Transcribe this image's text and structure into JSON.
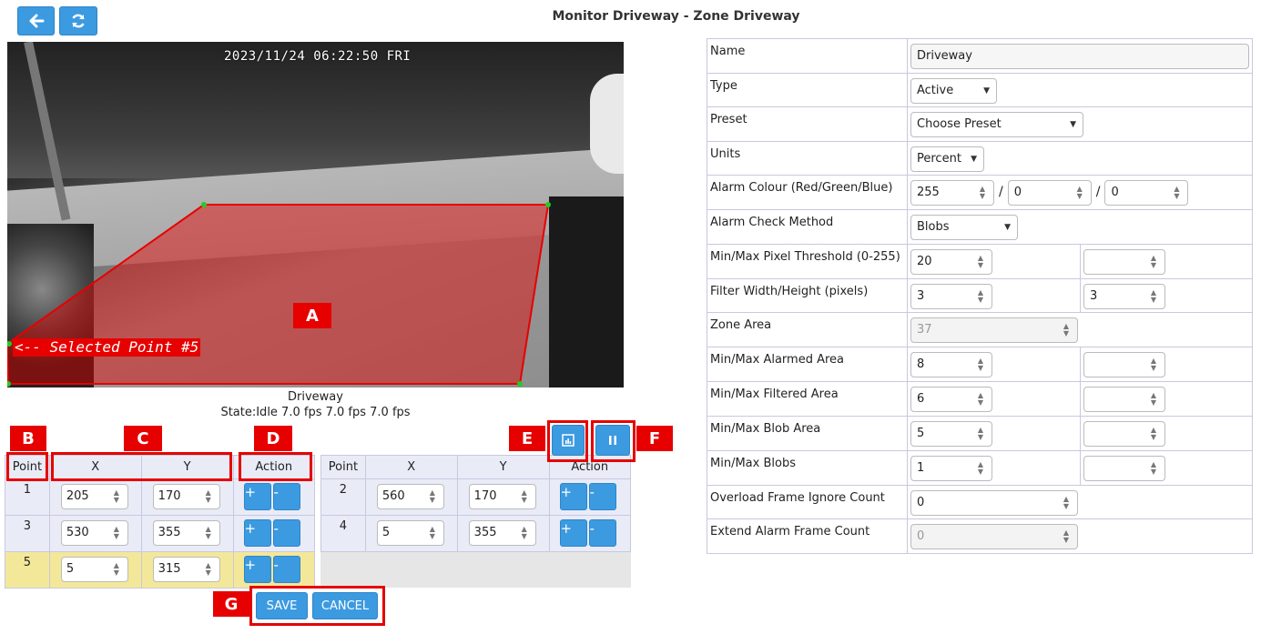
{
  "header": {
    "back_icon": "arrow-left-icon",
    "refresh_icon": "refresh-icon",
    "title": "Monitor Driveway - Zone Driveway"
  },
  "camera": {
    "timestamp": "2023/11/24 06:22:50 FRI",
    "selected_label": "<-- Selected Point #5",
    "monitor_name": "Driveway",
    "state": "State:Idle 7.0 fps 7.0 fps 7.0 fps",
    "zone_color": "#e60000"
  },
  "callouts": {
    "a": "A",
    "b": "B",
    "c": "C",
    "d": "D",
    "e": "E",
    "f": "F",
    "g": "G"
  },
  "points_headers": {
    "point": "Point",
    "x": "X",
    "y": "Y",
    "action": "Action"
  },
  "points_left": [
    {
      "n": "1",
      "x": "205",
      "y": "170",
      "selected": false
    },
    {
      "n": "3",
      "x": "530",
      "y": "355",
      "selected": false
    },
    {
      "n": "5",
      "x": "5",
      "y": "315",
      "selected": true
    }
  ],
  "points_right": [
    {
      "n": "2",
      "x": "560",
      "y": "170"
    },
    {
      "n": "4",
      "x": "5",
      "y": "355"
    }
  ],
  "action_labels": {
    "plus": "+",
    "minus": "-"
  },
  "toolbar": {
    "analyse_icon": "bar-chart-icon",
    "pause_icon": "pause-icon"
  },
  "footer": {
    "save": "SAVE",
    "cancel": "CANCEL"
  },
  "form": {
    "name_label": "Name",
    "name_value": "Driveway",
    "type_label": "Type",
    "type_value": "Active",
    "preset_label": "Preset",
    "preset_value": "Choose Preset",
    "units_label": "Units",
    "units_value": "Percent",
    "alarm_colour_label": "Alarm Colour (Red/Green/Blue)",
    "alarm_red": "255",
    "alarm_green": "0",
    "alarm_blue": "0",
    "check_method_label": "Alarm Check Method",
    "check_method_value": "Blobs",
    "pixel_threshold_label": "Min/Max Pixel Threshold (0-255)",
    "pixel_threshold_min": "20",
    "pixel_threshold_max": "",
    "filter_label": "Filter Width/Height (pixels)",
    "filter_width": "3",
    "filter_height": "3",
    "zone_area_label": "Zone Area",
    "zone_area_value": "37",
    "alarmed_area_label": "Min/Max Alarmed Area",
    "alarmed_area_min": "8",
    "alarmed_area_max": "",
    "filtered_area_label": "Min/Max Filtered Area",
    "filtered_area_min": "6",
    "filtered_area_max": "",
    "blob_area_label": "Min/Max Blob Area",
    "blob_area_min": "5",
    "blob_area_max": "",
    "blobs_label": "Min/Max Blobs",
    "blobs_min": "1",
    "blobs_max": "",
    "overload_label": "Overload Frame Ignore Count",
    "overload_value": "0",
    "extend_label": "Extend Alarm Frame Count",
    "extend_value": "0"
  }
}
